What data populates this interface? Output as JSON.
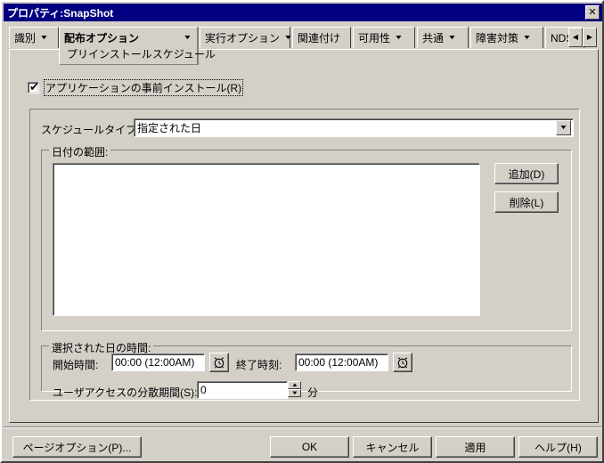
{
  "window": {
    "title": "プロパティ:SnapShot",
    "close_label": "✕"
  },
  "tabs": {
    "items": [
      {
        "label": "識別",
        "has_caret": true,
        "selected": false
      },
      {
        "label": "配布オプション",
        "sub_label": "プリインストールスケジュール",
        "has_caret": true,
        "selected": true
      },
      {
        "label": "実行オプション",
        "has_caret": true,
        "selected": false
      },
      {
        "label": "関連付け",
        "has_caret": false,
        "selected": false
      },
      {
        "label": "可用性",
        "has_caret": true,
        "selected": false
      },
      {
        "label": "共通",
        "has_caret": true,
        "selected": false
      },
      {
        "label": "障害対策",
        "has_caret": true,
        "selected": false
      },
      {
        "label": "NDS権",
        "has_caret": false,
        "selected": false
      }
    ],
    "scroll_left": "◀",
    "scroll_right": "▶"
  },
  "preinstall": {
    "checkbox_label": "アプリケーションの事前インストール(R)",
    "checked": true,
    "tick": "✔"
  },
  "schedule": {
    "type_label": "スケジュールタイプ:",
    "type_value": "指定された日",
    "dropdown_caret": "▼"
  },
  "date_range": {
    "group_title": "日付の範囲:",
    "items": [],
    "add_button": "追加(D)",
    "delete_button": "削除(L)"
  },
  "selected_day_time": {
    "group_title": "選択された日の時間:",
    "start_label": "開始時間:",
    "start_value": "00:00 (12:00AM)",
    "end_label": "終了時刻:",
    "end_value": "00:00 (12:00AM)",
    "spread_label": "ユーザアクセスの分散期間(S):",
    "spread_value": "0",
    "spread_unit": "分",
    "spin_up": "▲",
    "spin_down": "▼"
  },
  "footer": {
    "page_options": "ページオプション(P)...",
    "ok": "OK",
    "cancel": "キャンセル",
    "apply": "適用",
    "help": "ヘルプ(H)"
  },
  "colors": {
    "titlebar": "#000080",
    "dialog_face": "#d4d0c8",
    "field_bg": "#ffffff",
    "shadow": "#808080"
  }
}
